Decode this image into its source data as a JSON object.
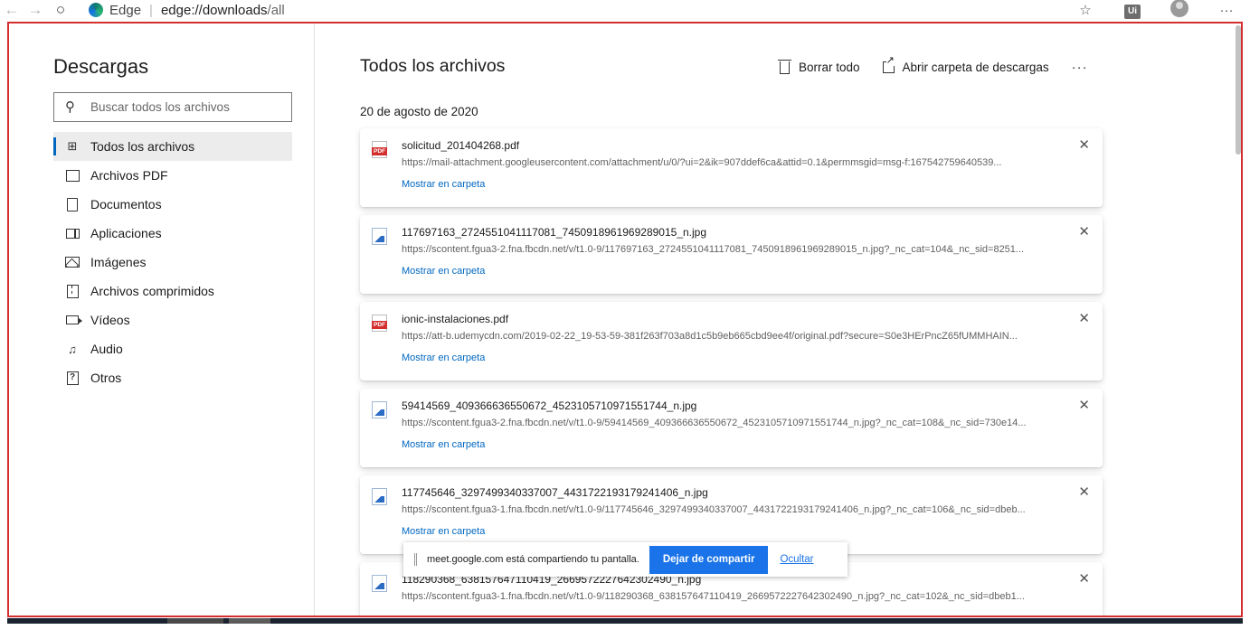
{
  "browser": {
    "site_name": "Edge",
    "url_host": "edge://downloads",
    "url_path": "/all"
  },
  "sidebar": {
    "title": "Descargas",
    "search_placeholder": "Buscar todos los archivos",
    "items": [
      {
        "label": "Todos los archivos",
        "icon": "grid-icon",
        "active": true
      },
      {
        "label": "Archivos PDF",
        "icon": "pdf-icon"
      },
      {
        "label": "Documentos",
        "icon": "document-icon"
      },
      {
        "label": "Aplicaciones",
        "icon": "application-icon"
      },
      {
        "label": "Imágenes",
        "icon": "image-icon"
      },
      {
        "label": "Archivos comprimidos",
        "icon": "zip-icon"
      },
      {
        "label": "Vídeos",
        "icon": "video-icon"
      },
      {
        "label": "Audio",
        "icon": "audio-icon"
      },
      {
        "label": "Otros",
        "icon": "other-icon"
      }
    ]
  },
  "main": {
    "title": "Todos los archivos",
    "clear_all": "Borrar todo",
    "open_folder": "Abrir carpeta de descargas",
    "more": "···",
    "date_group": "20 de agosto de 2020",
    "show_in_folder": "Mostrar en carpeta",
    "downloads": [
      {
        "name": "solicitud_201404268.pdf",
        "type": "pdf",
        "url": "https://mail-attachment.googleusercontent.com/attachment/u/0/?ui=2&ik=907ddef6ca&attid=0.1&permmsgid=msg-f:167542759640539..."
      },
      {
        "name": "117697163_2724551041117081_7450918961969289015_n.jpg",
        "type": "jpg",
        "url": "https://scontent.fgua3-2.fna.fbcdn.net/v/t1.0-9/117697163_2724551041117081_7450918961969289015_n.jpg?_nc_cat=104&_nc_sid=8251..."
      },
      {
        "name": "ionic-instalaciones.pdf",
        "type": "pdf",
        "url": "https://att-b.udemycdn.com/2019-02-22_19-53-59-381f263f703a8d1c5b9eb665cbd9ee4f/original.pdf?secure=S0e3HErPncZ65fUMMHAIN..."
      },
      {
        "name": "59414569_409366636550672_4523105710971551744_n.jpg",
        "type": "jpg",
        "url": "https://scontent.fgua3-2.fna.fbcdn.net/v/t1.0-9/59414569_409366636550672_4523105710971551744_n.jpg?_nc_cat=108&_nc_sid=730e14..."
      },
      {
        "name": "117745646_3297499340337007_4431722193179241406_n.jpg",
        "type": "jpg",
        "url": "https://scontent.fgua3-1.fna.fbcdn.net/v/t1.0-9/117745646_3297499340337007_4431722193179241406_n.jpg?_nc_cat=106&_nc_sid=dbeb..."
      },
      {
        "name": "118290368_638157647110419_2669572227642302490_n.jpg",
        "type": "jpg",
        "url": "https://scontent.fgua3-1.fna.fbcdn.net/v/t1.0-9/118290368_638157647110419_2669572227642302490_n.jpg?_nc_cat=102&_nc_sid=dbeb1..."
      }
    ]
  },
  "share_bar": {
    "message": "meet.google.com está compartiendo tu pantalla.",
    "stop_button": "Dejar de compartir",
    "hide_link": "Ocultar"
  },
  "colors": {
    "accent": "#0067c0",
    "highlight_frame": "#d32f2f",
    "share_button": "#1a73e8"
  }
}
